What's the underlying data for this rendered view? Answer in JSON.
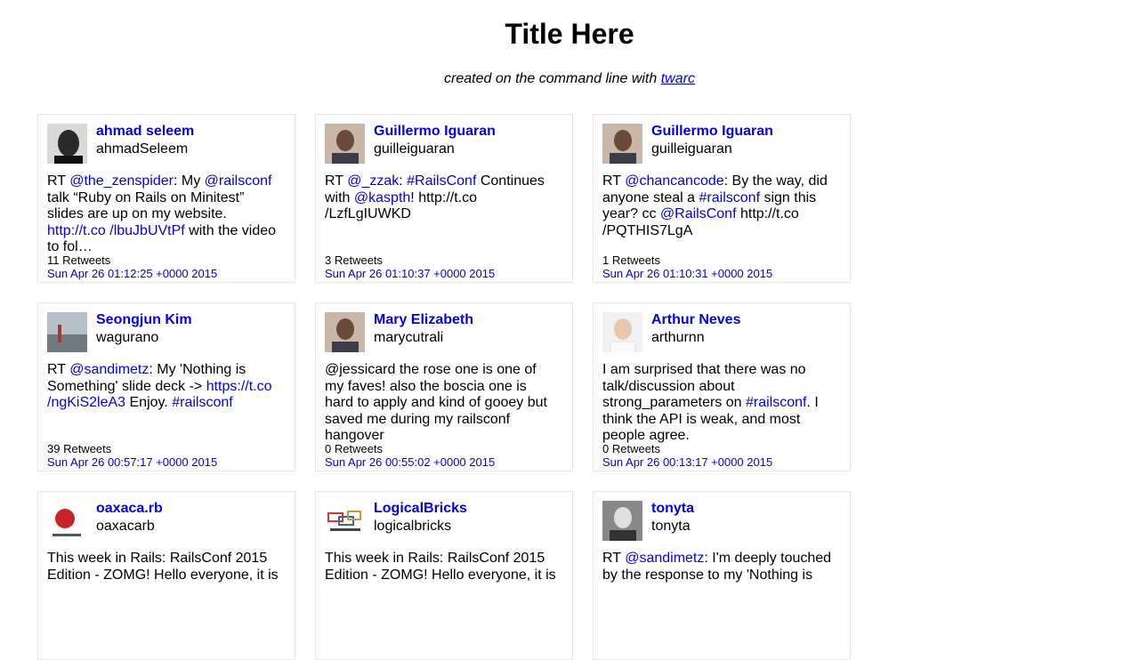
{
  "header": {
    "title": "Title Here",
    "subtitle_prefix": "created on the command line with ",
    "subtitle_link": "twarc"
  },
  "tweets": [
    {
      "name": "ahmad seleem",
      "handle": "ahmadSeleem",
      "text": [
        {
          "t": "RT "
        },
        {
          "t": "@the_zenspider",
          "link": true
        },
        {
          "t": ": My "
        },
        {
          "t": "@railsconf",
          "link": true
        },
        {
          "t": " talk “Ruby on Rails on Minitest” slides are up on my website. "
        },
        {
          "t": "http://t.co /lbuJbUVtPf",
          "link": true
        },
        {
          "t": " with the video to fol…"
        }
      ],
      "retweets": "11 Retweets",
      "date": "Sun Apr 26 01:12:25 +0000 2015",
      "avatar": "person-avatar-dark"
    },
    {
      "name": "Guillermo Iguaran",
      "handle": "guilleiguaran",
      "text": [
        {
          "t": "RT "
        },
        {
          "t": "@_zzak",
          "link": true
        },
        {
          "t": ": "
        },
        {
          "t": "#RailsConf",
          "link": true
        },
        {
          "t": " Continues with "
        },
        {
          "t": "@kaspth",
          "link": true
        },
        {
          "t": "! http://t.co /LzfLgIUWKD"
        }
      ],
      "retweets": "3 Retweets",
      "date": "Sun Apr 26 01:10:37 +0000 2015",
      "avatar": "person-avatar"
    },
    {
      "name": "Guillermo Iguaran",
      "handle": "guilleiguaran",
      "text": [
        {
          "t": "RT "
        },
        {
          "t": "@chancancode",
          "link": true
        },
        {
          "t": ": By the way, did anyone steal a "
        },
        {
          "t": "#railsconf",
          "link": true
        },
        {
          "t": " sign this year? cc "
        },
        {
          "t": "@RailsConf",
          "link": true
        },
        {
          "t": " http://t.co /PQTHIS7LgA"
        }
      ],
      "retweets": "1 Retweets",
      "date": "Sun Apr 26 01:10:31 +0000 2015",
      "avatar": "person-avatar"
    },
    {
      "name": "Seongjun Kim",
      "handle": "wagurano",
      "text": [
        {
          "t": "RT "
        },
        {
          "t": "@sandimetz",
          "link": true
        },
        {
          "t": ": My 'Nothing is Something' slide deck -> "
        },
        {
          "t": "https://t.co /ngKiS2leA3",
          "link": true
        },
        {
          "t": " Enjoy. "
        },
        {
          "t": "#railsconf",
          "link": true
        }
      ],
      "retweets": "39 Retweets",
      "date": "Sun Apr 26 00:57:17 +0000 2015",
      "avatar": "landscape-avatar"
    },
    {
      "name": "Mary Elizabeth",
      "handle": "marycutrali",
      "text": [
        {
          "t": "@jessicard the rose one is one of my faves! also the boscia one is hard to apply and kind of gooey but saved me during my railsconf hangover"
        }
      ],
      "retweets": "0 Retweets",
      "date": "Sun Apr 26 00:55:02 +0000 2015",
      "avatar": "person-avatar"
    },
    {
      "name": "Arthur Neves",
      "handle": "arthurnn",
      "text": [
        {
          "t": "I am surprised that there was no talk/discussion about strong_parameters on "
        },
        {
          "t": "#railsconf",
          "link": true
        },
        {
          "t": ". I think the API is weak, and most people agree."
        }
      ],
      "retweets": "0 Retweets",
      "date": "Sun Apr 26 00:13:17 +0000 2015",
      "avatar": "person-avatar-light"
    },
    {
      "name": "oaxaca.rb",
      "handle": "oaxacarb",
      "text": [
        {
          "t": "This week in Rails: RailsConf 2015 Edition - ZOMG! Hello everyone, it is"
        }
      ],
      "retweets": "",
      "date": "",
      "avatar": "logo-avatar-red"
    },
    {
      "name": "LogicalBricks",
      "handle": "logicalbricks",
      "text": [
        {
          "t": "This week in Rails: RailsConf 2015 Edition - ZOMG! Hello everyone, it is"
        }
      ],
      "retweets": "",
      "date": "",
      "avatar": "logo-avatar-bricks"
    },
    {
      "name": "tonyta",
      "handle": "tonyta",
      "text": [
        {
          "t": "RT "
        },
        {
          "t": "@sandimetz",
          "link": true
        },
        {
          "t": ": I'm deeply touched by the response to my 'Nothing is"
        }
      ],
      "retweets": "",
      "date": "",
      "avatar": "person-avatar-bw"
    }
  ],
  "colors": {
    "link": "#0000ee",
    "border": "#e6e6e6"
  }
}
